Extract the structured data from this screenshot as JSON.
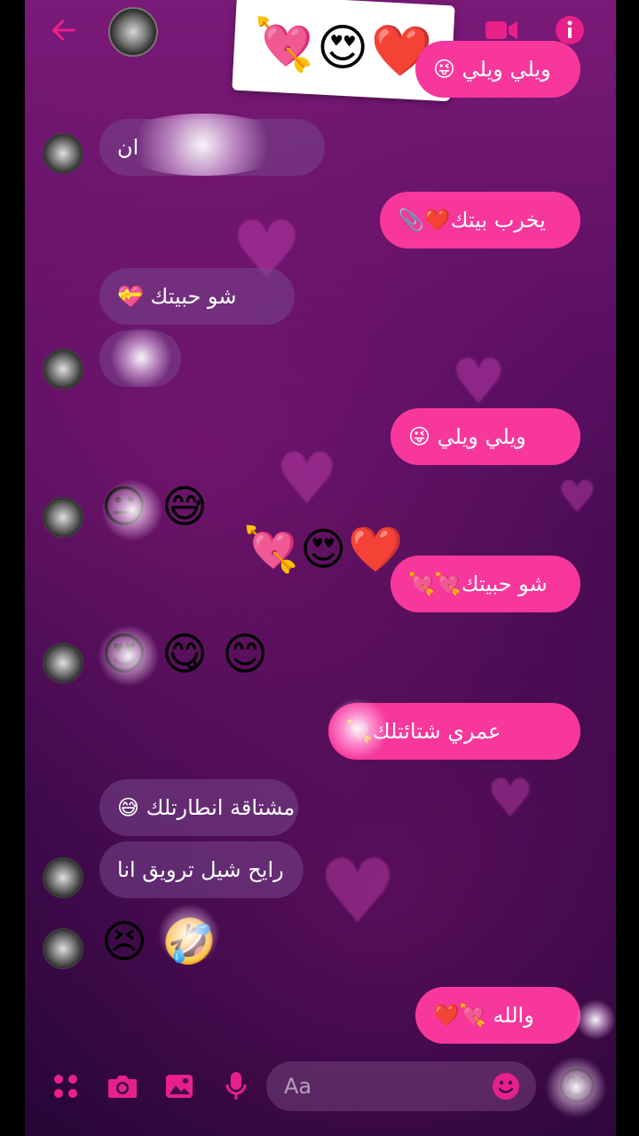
{
  "colors": {
    "accent": "#f7379b",
    "accent_icon": "#e8208a",
    "header_bg": "#7b1a78"
  },
  "header": {
    "back_icon": "arrow-left-icon",
    "video_icon": "video-call-icon",
    "info_icon": "info-icon",
    "sticker_emojis": "💘😍❤️"
  },
  "messages": [
    {
      "side": "out",
      "text": "ويلي ويلي 😜"
    },
    {
      "side": "in",
      "text": "ان"
    },
    {
      "side": "out",
      "text": "يخرب بيتك❤️📎"
    },
    {
      "side": "in",
      "text": "شو حبيتك 💝"
    },
    {
      "side": "in",
      "text": ""
    },
    {
      "side": "out",
      "text": "ويلي ويلي 😜"
    },
    {
      "side": "in",
      "emoji": "😐 😅"
    },
    {
      "side": "out",
      "text": "شو حبيتك💘💘"
    },
    {
      "side": "in",
      "emoji": "😍 😋 😊"
    },
    {
      "side": "out",
      "text": "عمري شتائتلك💘"
    },
    {
      "side": "in",
      "text": "مشتاقة انطارتلك 😅"
    },
    {
      "side": "in",
      "text": "رايح شيل ترويق انا"
    },
    {
      "side": "in",
      "emoji": "😣 🤣"
    },
    {
      "side": "out",
      "text": "والله 💘❤️"
    }
  ],
  "floating": "💘😍❤️",
  "composer": {
    "placeholder": "Aa",
    "menu_icon": "apps-grid-icon",
    "camera_icon": "camera-icon",
    "gallery_icon": "image-icon",
    "mic_icon": "microphone-icon",
    "emoji_icon": "smiley-icon",
    "quick_reaction": "😊"
  }
}
